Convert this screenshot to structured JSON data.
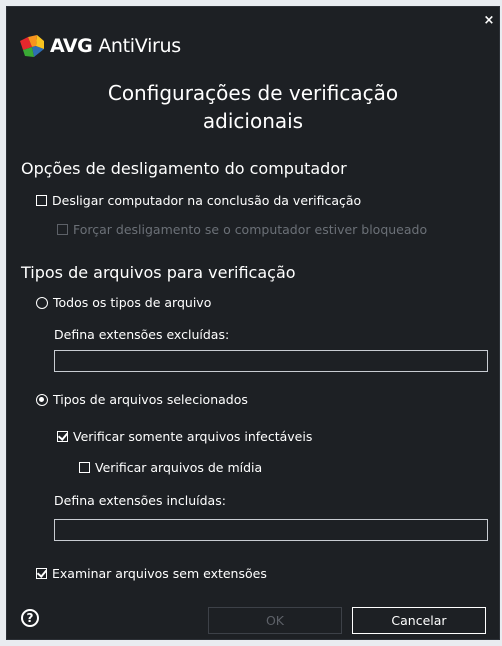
{
  "window": {
    "brand": "AVG",
    "product": "AntiVirus",
    "title": "Configurações de verificação adicionais",
    "title_line1": "Configurações de verificação",
    "title_line2": "adicionais"
  },
  "shutdown": {
    "heading": "Opções de desligamento do computador",
    "shutdown_on_complete": {
      "label": "Desligar computador na conclusão da verificação",
      "checked": false
    },
    "force_shutdown": {
      "label": "Forçar desligamento se o computador estiver bloqueado",
      "checked": false,
      "enabled": false
    }
  },
  "file_types": {
    "heading": "Tipos de arquivos para verificação",
    "all_types": {
      "label": "Todos os tipos de arquivo",
      "selected": false
    },
    "excluded_extensions": {
      "label": "Defina extensões excluídas:",
      "value": ""
    },
    "selected_types": {
      "label": "Tipos de arquivos selecionados",
      "selected": true
    },
    "infectable_only": {
      "label": "Verificar somente arquivos infectáveis",
      "checked": true
    },
    "media_files": {
      "label": "Verificar arquivos de mídia",
      "checked": false
    },
    "included_extensions": {
      "label": "Defina extensões incluídas:",
      "value": ""
    },
    "no_extension": {
      "label": "Examinar arquivos sem extensões",
      "checked": true
    }
  },
  "footer": {
    "help_icon": "?",
    "ok_label": "OK",
    "cancel_label": "Cancelar"
  },
  "icons": {
    "close": "×"
  },
  "colors": {
    "background": "#1d2024",
    "text": "#ffffff",
    "disabled_text": "#6b7077",
    "logo_red": "#e4282d",
    "logo_orange": "#f7931e",
    "logo_green": "#3aaa35",
    "logo_blue": "#2e6db4"
  }
}
